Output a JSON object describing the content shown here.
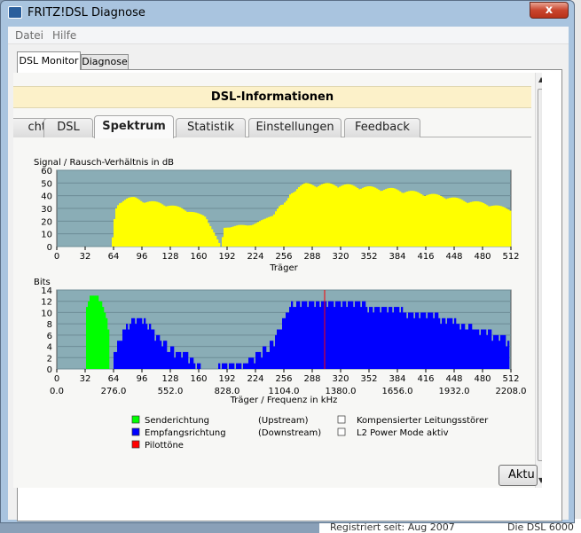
{
  "window": {
    "title": "FRITZ!DSL Diagnose",
    "close_glyph": "x"
  },
  "menu": {
    "file": "Datei",
    "help": "Hilfe"
  },
  "main_tabs": [
    "DSL Monitor",
    "Diagnose"
  ],
  "header": "DSL-Informationen",
  "sub_tabs": [
    "cht",
    "DSL",
    "Spektrum",
    "Statistik",
    "Einstellungen",
    "Feedback"
  ],
  "active_sub_tab": "Spektrum",
  "button_label": "Aktu",
  "background_text": {
    "registered": "Registriert seit: Aug 2007",
    "right": "Die DSL 6000"
  },
  "colors": {
    "plot_bg": "#8aadb6",
    "snr": "#ffff00",
    "upstream": "#00ff00",
    "downstream": "#0000ff",
    "pilot": "#ff0000"
  },
  "chart_data": [
    {
      "type": "area",
      "ylabel": "Signal / Rausch-Verhältnis in dB",
      "xlabel": "Träger",
      "ylim": [
        0,
        60
      ],
      "yticks": [
        0,
        10,
        20,
        30,
        40,
        50,
        60
      ],
      "xlim": [
        0,
        512
      ],
      "xticks": [
        0,
        32,
        64,
        96,
        128,
        160,
        192,
        224,
        256,
        288,
        320,
        352,
        384,
        416,
        448,
        480,
        512
      ],
      "grid": true,
      "x": [
        0,
        62,
        66,
        70,
        75,
        80,
        88,
        96,
        106,
        116,
        128,
        140,
        152,
        160,
        165,
        168,
        185,
        189,
        195,
        205,
        215,
        225,
        235,
        244,
        248,
        252,
        255,
        260,
        263,
        268,
        272,
        276,
        280,
        284,
        288,
        296,
        305,
        315,
        330,
        345,
        360,
        380,
        400,
        420,
        440,
        460,
        480,
        500,
        512
      ],
      "values": [
        0,
        0,
        29,
        35,
        38,
        39,
        39,
        37,
        36,
        35,
        33,
        31,
        28,
        26,
        25,
        24,
        0,
        15,
        16,
        17,
        17,
        19,
        22,
        26,
        30,
        33,
        33,
        37,
        42,
        46,
        48,
        49,
        50,
        50,
        50,
        50,
        50,
        50,
        49,
        48,
        47,
        46,
        44,
        42,
        40,
        37,
        35,
        32,
        30
      ]
    },
    {
      "type": "bar",
      "ylabel": "Bits",
      "xlabel": "Träger / Frequenz in kHz",
      "ylim": [
        0,
        14
      ],
      "yticks": [
        0,
        2,
        4,
        6,
        8,
        10,
        12,
        14
      ],
      "xlim": [
        0,
        512
      ],
      "xticks": [
        0,
        32,
        64,
        96,
        128,
        160,
        192,
        224,
        256,
        288,
        320,
        352,
        384,
        416,
        448,
        480,
        512
      ],
      "xticks_khz": [
        "0.0",
        "276.0",
        "552.0",
        "828.0",
        "1104.0",
        "1380.0",
        "1656.0",
        "1932.0",
        "2208.0"
      ],
      "grid": true,
      "series": [
        {
          "name": "Senderichtung",
          "x": [
            33,
            36,
            40,
            44,
            48,
            52,
            56,
            59
          ],
          "values": [
            10,
            12,
            13,
            13,
            12,
            11,
            9,
            6
          ]
        },
        {
          "name": "Empfangsrichtung",
          "x": [
            64,
            70,
            76,
            82,
            88,
            96,
            104,
            112,
            120,
            128,
            136,
            144,
            152,
            160,
            168,
            176,
            190,
            200,
            210,
            220,
            228,
            236,
            244,
            250,
            256,
            262,
            268,
            276,
            284,
            292,
            300,
            310,
            320,
            340,
            360,
            380,
            400,
            420,
            440,
            460,
            480,
            500,
            510
          ],
          "values": [
            2,
            5,
            7,
            8,
            9,
            9,
            8,
            6,
            5,
            4,
            3,
            3,
            2,
            1,
            0,
            0,
            1,
            1,
            1,
            2,
            3,
            4,
            5,
            7,
            9,
            11,
            12,
            12,
            12,
            12,
            12,
            12,
            12,
            12,
            11,
            11,
            10,
            10,
            9,
            8,
            7,
            6,
            5
          ]
        }
      ],
      "pilot_carrier": 302,
      "legend": [
        {
          "label": "Senderichtung",
          "note": "(Upstream)"
        },
        {
          "label": "Empfangsrichtung",
          "note": "(Downstream)"
        },
        {
          "label": "Pilottöne",
          "note": ""
        },
        {
          "label": "Kompensierter Leitungsstörer",
          "note": ""
        },
        {
          "label": "L2 Power Mode aktiv",
          "note": ""
        }
      ]
    }
  ]
}
